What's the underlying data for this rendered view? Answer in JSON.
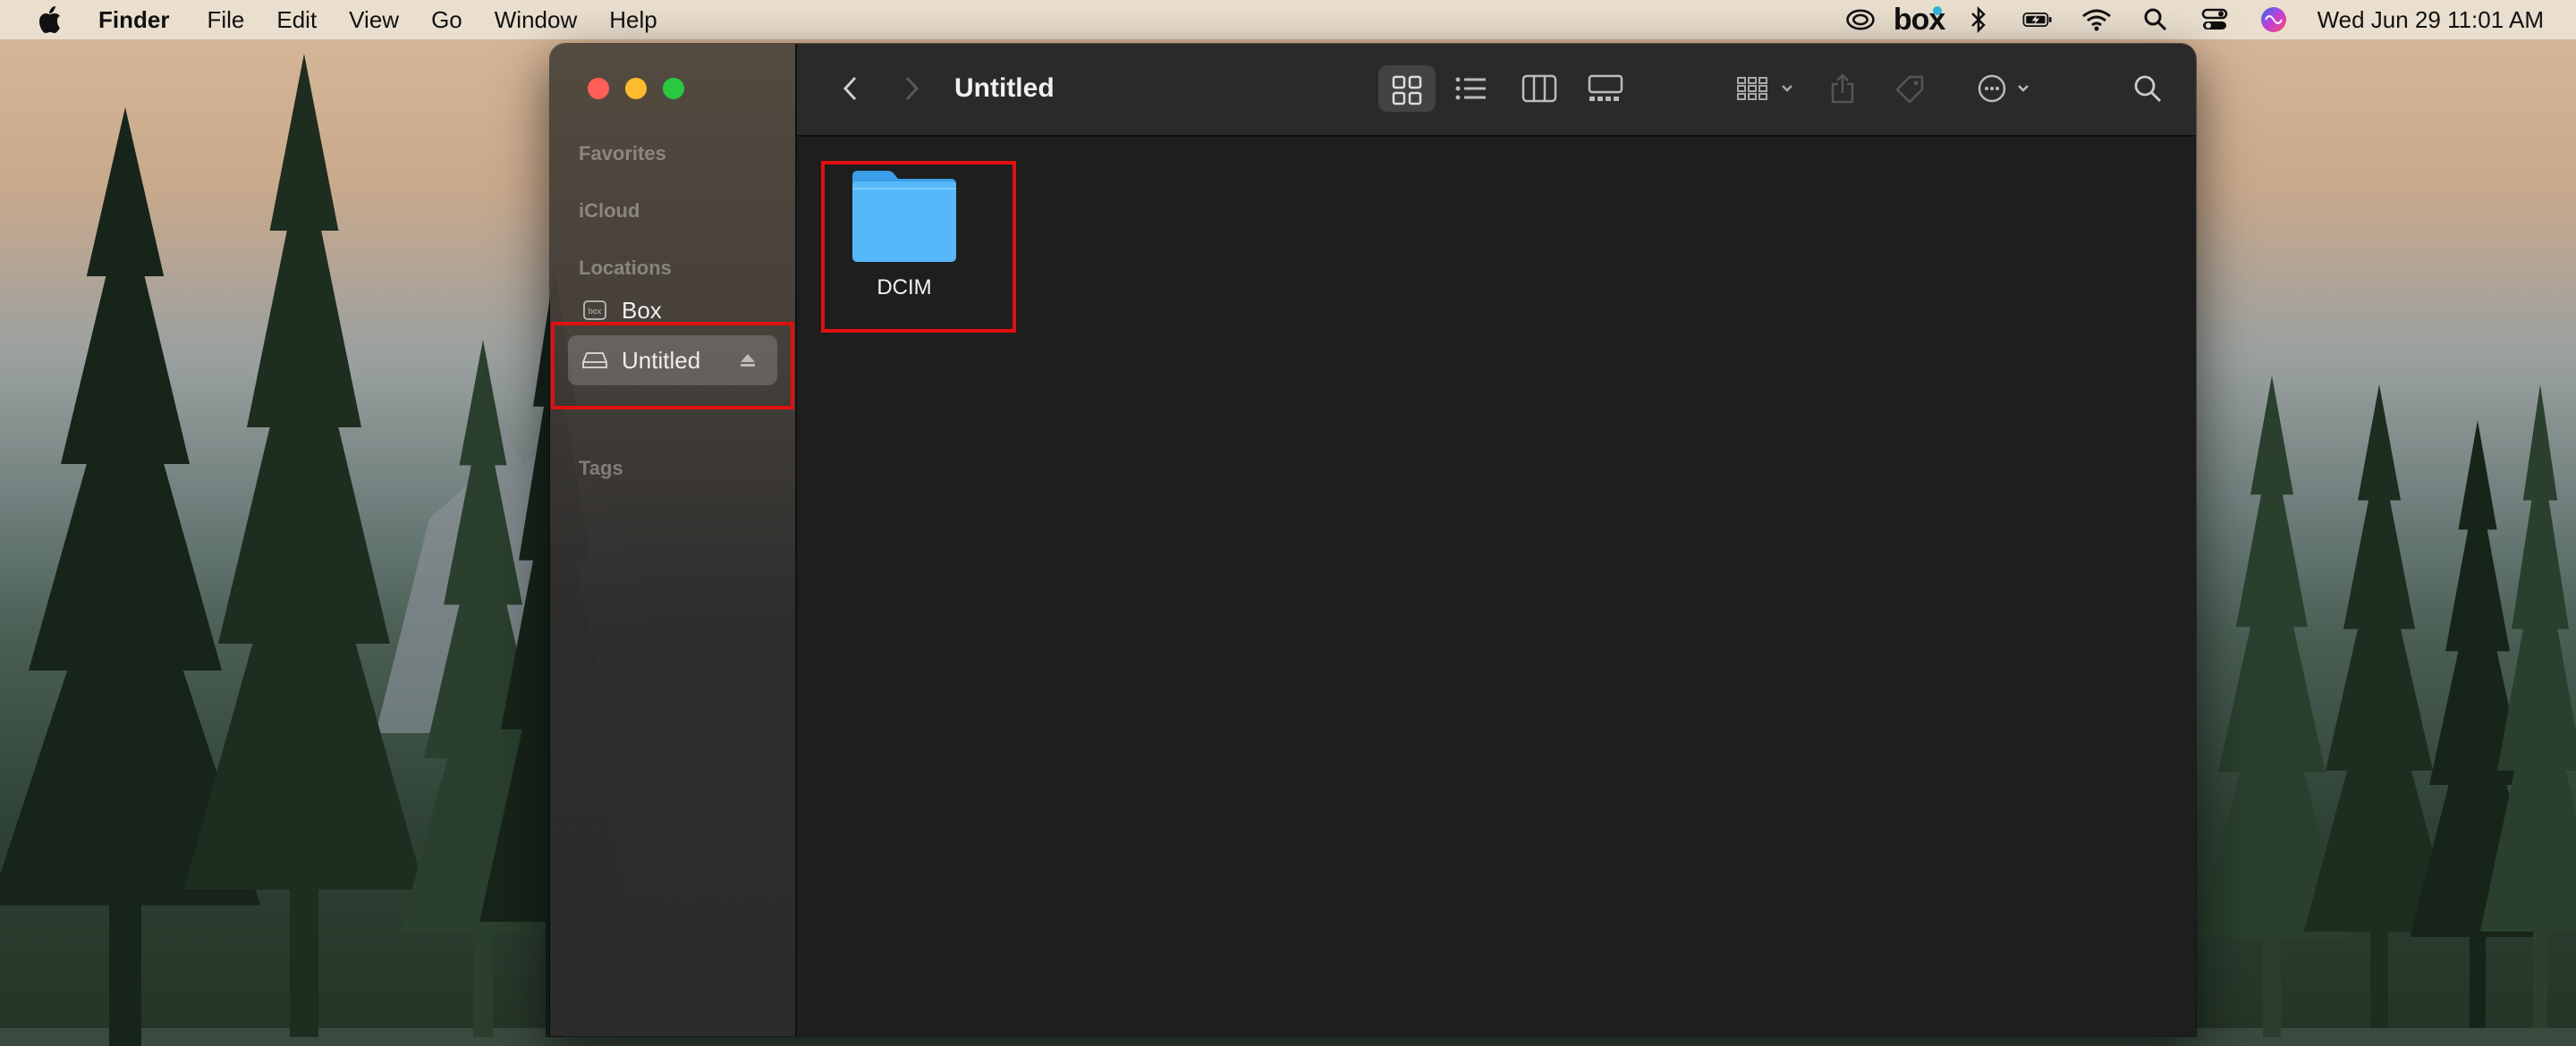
{
  "menubar": {
    "app_name": "Finder",
    "menus": [
      "File",
      "Edit",
      "View",
      "Go",
      "Window",
      "Help"
    ],
    "status_icons": [
      "creative-cloud-icon",
      "box-icon",
      "bluetooth-icon",
      "battery-icon",
      "wifi-icon",
      "search-icon",
      "control-center-icon",
      "siri-icon"
    ],
    "box_label": "box",
    "clock": "Wed Jun 29  11:01 AM"
  },
  "sidebar": {
    "favorites_label": "Favorites",
    "icloud_label": "iCloud",
    "locations_label": "Locations",
    "locations": [
      {
        "label": "Box",
        "icon": "box-drive-icon"
      },
      {
        "label": "Untitled",
        "icon": "external-drive-icon",
        "selected": true
      }
    ],
    "tags_label": "Tags"
  },
  "toolbar": {
    "title": "Untitled"
  },
  "content": {
    "items": [
      {
        "name": "DCIM",
        "type": "folder",
        "color": "#4fb3f6"
      }
    ]
  },
  "colors": {
    "highlight": "#e01010",
    "window_bg": "#1e1e1e",
    "folder_blue": "#4fb3f6"
  }
}
